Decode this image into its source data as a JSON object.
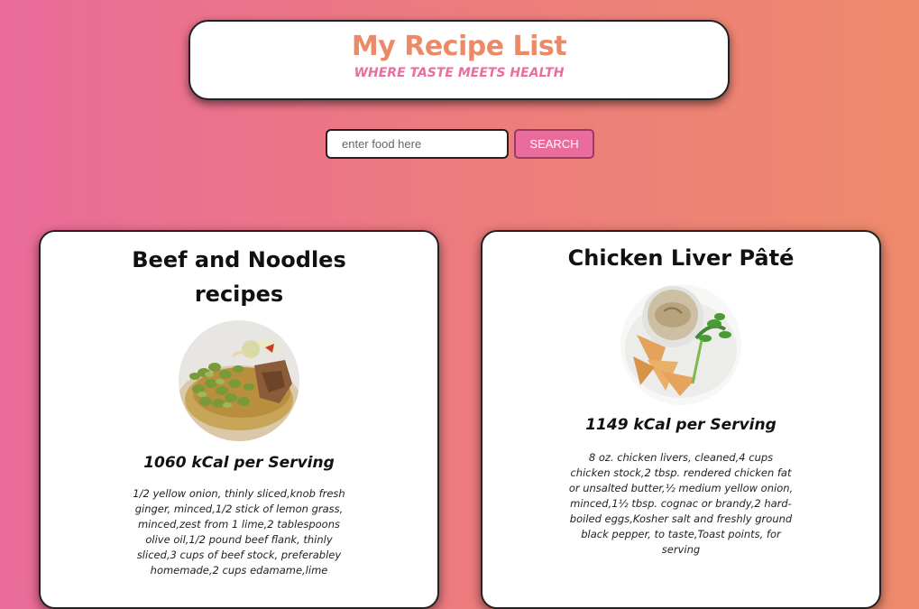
{
  "header": {
    "title": "My Recipe List",
    "tagline": "WHERE TASTE MEETS HEALTH"
  },
  "search": {
    "placeholder": "enter food here",
    "button_label": "SEARCH"
  },
  "recipes": [
    {
      "title": "Beef and Noodles recipes",
      "image_icon": "beef-noodles-dish-image",
      "kcal": "1060 kCal per Serving",
      "ingredients": "1/2 yellow onion, thinly sliced,knob fresh ginger, minced,1/2 stick of lemon grass, minced,zest from 1 lime,2 tablespoons olive oil,1/2 pound beef flank, thinly sliced,3 cups of beef stock, preferabley homemade,2 cups edamame,lime"
    },
    {
      "title": "Chicken Liver Pâté",
      "image_icon": "chicken-liver-pate-image",
      "kcal": "1149 kCal per Serving",
      "ingredients": "8 oz. chicken livers, cleaned,4 cups chicken stock,2 tbsp. rendered chicken fat or unsalted butter,½ medium yellow onion, minced,1½ tbsp. cognac or brandy,2 hard-boiled eggs,Kosher salt and freshly ground black pepper, to taste,Toast points, for serving"
    }
  ],
  "colors": {
    "accent_orange": "#ec8a68",
    "accent_pink": "#e96ea0",
    "background_start": "#ea6b9a",
    "background_end": "#ee8a6c"
  }
}
